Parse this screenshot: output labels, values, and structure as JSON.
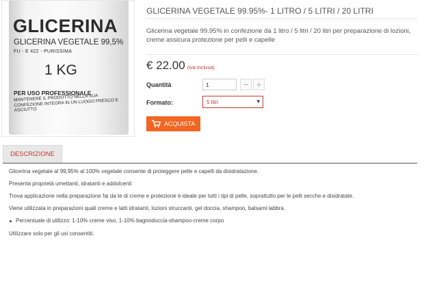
{
  "product": {
    "image_label": {
      "brand": "GLICERINA",
      "subtitle": "GLICERINA VEGETALE 99,5%",
      "code": "FU - E 422 - PURISSIMA",
      "weight": "1 KG",
      "use": "PER USO PROFESSIONALE",
      "warning": "MANTENERE IL PRODOTTO NELLA SUA CONFEZIONE INTEGRA IN UN LUOGO FRESCO E ASCIUTTO"
    },
    "title": "GLICERINA VEGETALE 99.95%- 1 LITRO / 5 LITRI / 20 LITRI",
    "summary": "Glicerina vegetale 99.95% in confezione da 1 litro / 5 litri / 20 litri per preparazione di lozioni, creme assicura protezione per pelli e capelle",
    "price": "€ 22.00",
    "price_note": "(iva inclusa)",
    "quantity_label": "Quantità",
    "quantity_value": "1",
    "minus_label": "−",
    "plus_label": "+",
    "format_label": "Formato:",
    "format_selected": "5 litri",
    "buy_label": "ACQUISTA"
  },
  "tabs": {
    "description": "DESCRIZIONE"
  },
  "description": {
    "paragraphs": [
      "Glicerina vegetale al 99,95% al 100% vegetale consente di proteggere pelle e capelli da disidratazione.",
      "Presenta proprietà umettanti, idratanti e addolcenti",
      "Trova applicazione nella preparazione fai da te di creme e protezione è ideale per tutti i tipi di pelle, soprattutto per le pelli secche e disidratate.",
      "Viene utilizzata in preparazioni quali creme e latti idratanti, lozioni struccanti, gel doccia, shampoo, balsami labbra."
    ],
    "bullet": "Percentuale di utilizzo: 1-10% creme viso, 1-10% bagnodoccia-shampoo-creme corpo",
    "footer": "Utilizzare solo per gli usi consentiti."
  },
  "colors": {
    "accent": "#f26522",
    "link_red": "#c0392b"
  },
  "icons": {
    "cart": "cart-icon",
    "caret": "caret-down-icon"
  }
}
